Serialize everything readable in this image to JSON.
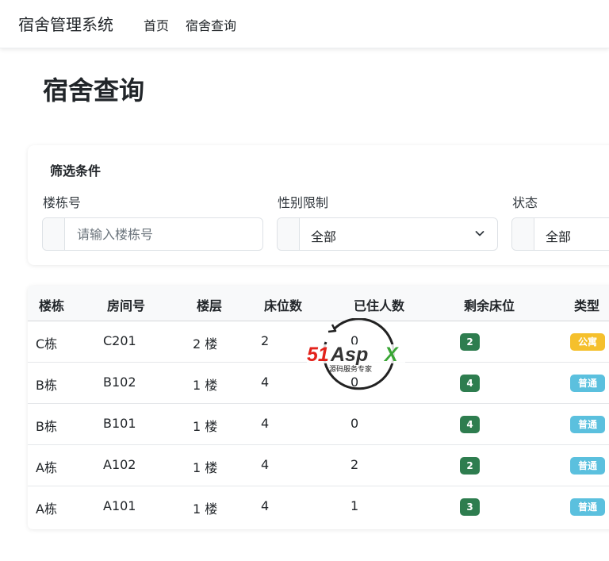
{
  "navbar": {
    "brand": "宿舍管理系统",
    "links": [
      "首页",
      "宿舍查询"
    ]
  },
  "page": {
    "title": "宿舍查询"
  },
  "filters": {
    "title": "筛选条件",
    "building": {
      "label": "楼栋号",
      "placeholder": "请输入楼栋号",
      "value": ""
    },
    "gender": {
      "label": "性别限制",
      "value": "全部"
    },
    "status": {
      "label": "状态",
      "value": "全部"
    }
  },
  "table": {
    "headers": [
      "楼栋",
      "房间号",
      "楼层",
      "床位数",
      "已住人数",
      "剩余床位",
      "类型"
    ],
    "rows": [
      {
        "building": "C栋",
        "room": "C201",
        "floor": "2 楼",
        "beds": "2",
        "occupied": "0",
        "remaining": "2",
        "type": "公寓"
      },
      {
        "building": "B栋",
        "room": "B102",
        "floor": "1 楼",
        "beds": "4",
        "occupied": "0",
        "remaining": "4",
        "type": "普通"
      },
      {
        "building": "B栋",
        "room": "B101",
        "floor": "1 楼",
        "beds": "4",
        "occupied": "0",
        "remaining": "4",
        "type": "普通"
      },
      {
        "building": "A栋",
        "room": "A102",
        "floor": "1 楼",
        "beds": "4",
        "occupied": "2",
        "remaining": "2",
        "type": "普通"
      },
      {
        "building": "A栋",
        "room": "A101",
        "floor": "1 楼",
        "beds": "4",
        "occupied": "1",
        "remaining": "3",
        "type": "普通"
      }
    ]
  },
  "watermark": {
    "logo": "51Aspx",
    "tagline": "源码服务专家"
  },
  "colors": {
    "badge_remaining": "#2e7d4f",
    "type_apartment": "#f5c02c",
    "type_normal": "#5bc0de"
  }
}
